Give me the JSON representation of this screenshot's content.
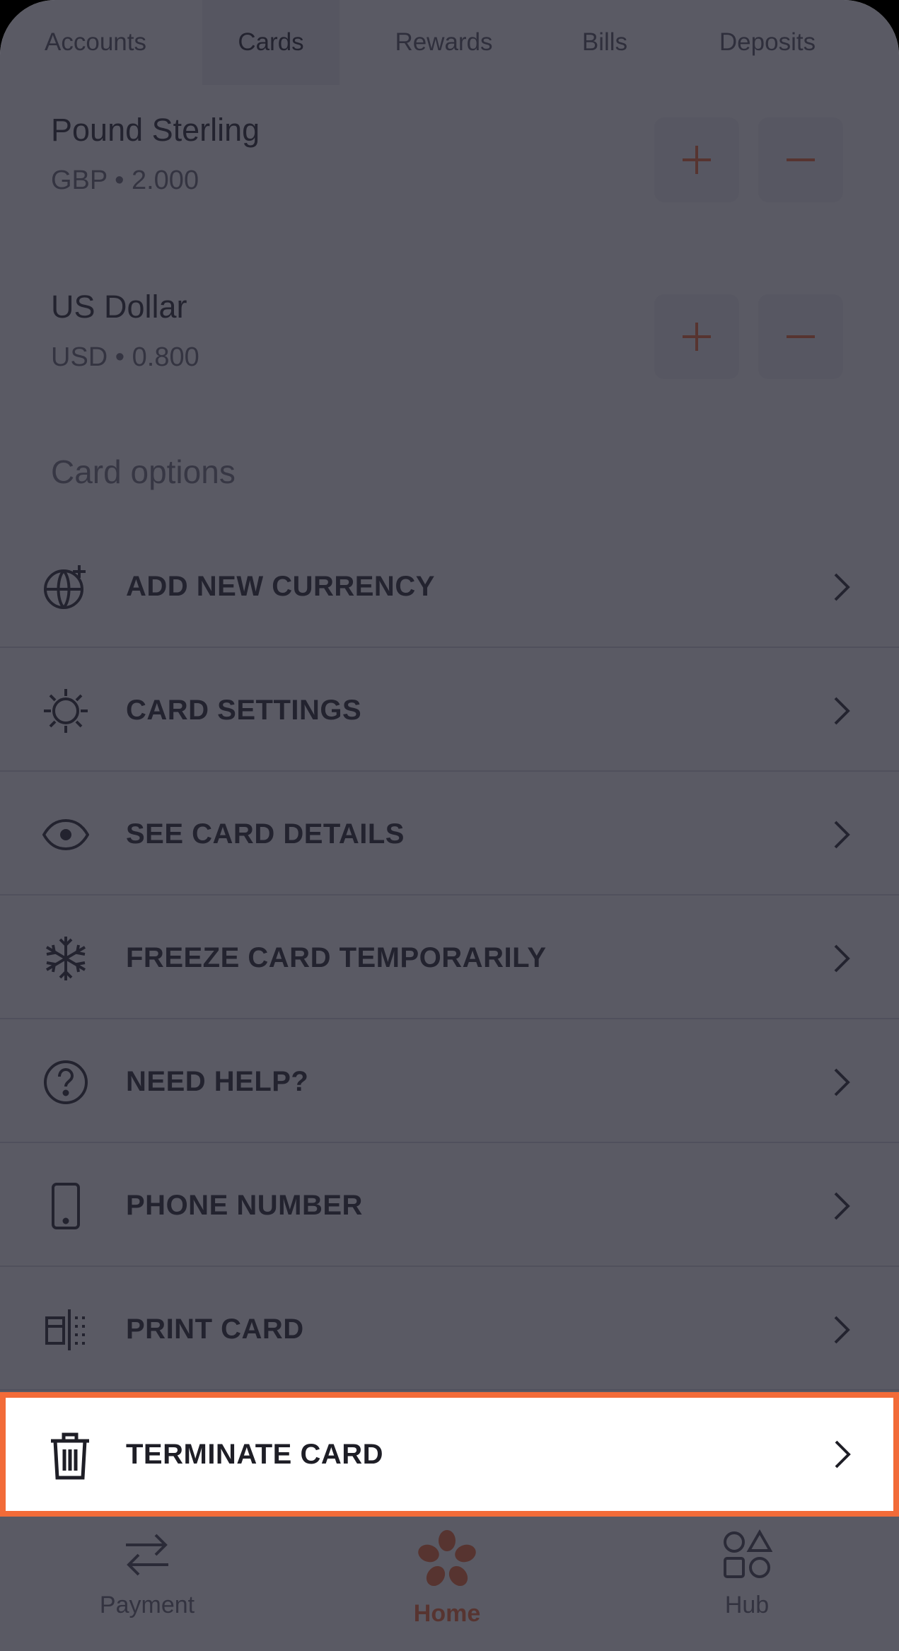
{
  "tabs": [
    "Accounts",
    "Cards",
    "Rewards",
    "Bills",
    "Deposits"
  ],
  "currencies": [
    {
      "name": "Pound Sterling",
      "sub": "GBP • 2.000"
    },
    {
      "name": "US Dollar",
      "sub": "USD • 0.800"
    }
  ],
  "card_options_title": "Card options",
  "options": [
    {
      "label": "ADD NEW CURRENCY",
      "icon": "globe-plus-icon"
    },
    {
      "label": "CARD SETTINGS",
      "icon": "gear-icon"
    },
    {
      "label": "SEE CARD DETAILS",
      "icon": "eye-icon"
    },
    {
      "label": "FREEZE CARD TEMPORARILY",
      "icon": "snowflake-icon"
    },
    {
      "label": "NEED HELP?",
      "icon": "question-icon"
    },
    {
      "label": "PHONE NUMBER",
      "icon": "phone-icon"
    },
    {
      "label": "PRINT CARD",
      "icon": "print-card-icon"
    }
  ],
  "highlighted_option": {
    "label": "TERMINATE CARD",
    "icon": "trash-icon"
  },
  "bottom_nav": [
    "Payment",
    "Home",
    "Hub"
  ],
  "colors": {
    "accent": "#f26b38",
    "overlay": "#20202e"
  }
}
